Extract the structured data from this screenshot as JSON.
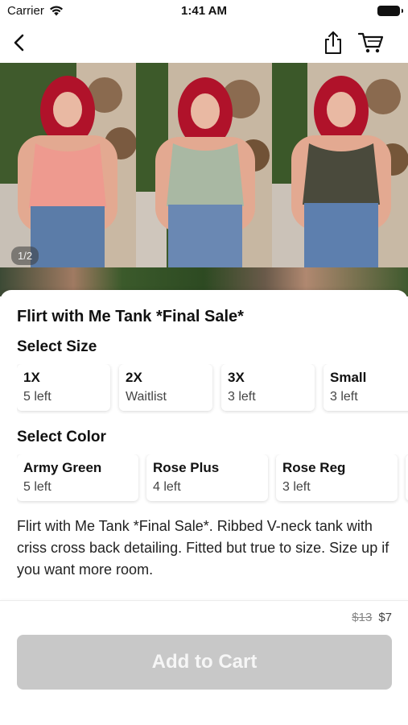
{
  "status_bar": {
    "carrier": "Carrier",
    "time": "1:41 AM"
  },
  "nav": {
    "back_icon": "chevron-left-icon",
    "share_icon": "share-icon",
    "cart_icon": "cart-icon"
  },
  "gallery": {
    "page_indicator": "1/2",
    "tank_colors": [
      "#ee9a8f",
      "#a9b8a3",
      "#4a4a3c"
    ]
  },
  "product": {
    "title": "Flirt with Me Tank *Final Sale*",
    "size_heading": "Select Size",
    "sizes": [
      {
        "name": "1X",
        "stock": "5 left"
      },
      {
        "name": "2X",
        "stock": "Waitlist"
      },
      {
        "name": "3X",
        "stock": "3 left"
      },
      {
        "name": "Small",
        "stock": "3 left"
      }
    ],
    "color_heading": "Select Color",
    "colors": [
      {
        "name": "Army Green",
        "stock": "5 left"
      },
      {
        "name": "Rose Plus",
        "stock": "4 left"
      },
      {
        "name": "Rose Reg",
        "stock": "3 left"
      }
    ],
    "description": "Flirt with Me Tank *Final Sale*. Ribbed V-neck tank with  criss cross back detailing. Fitted but true to size. Size up if you want more room.",
    "price_original": "$13",
    "price_sale": "$7"
  },
  "cta": {
    "add_to_cart_label": "Add to Cart"
  },
  "colors": {
    "button_disabled": "#c8c8c8",
    "text_primary": "#111111"
  }
}
